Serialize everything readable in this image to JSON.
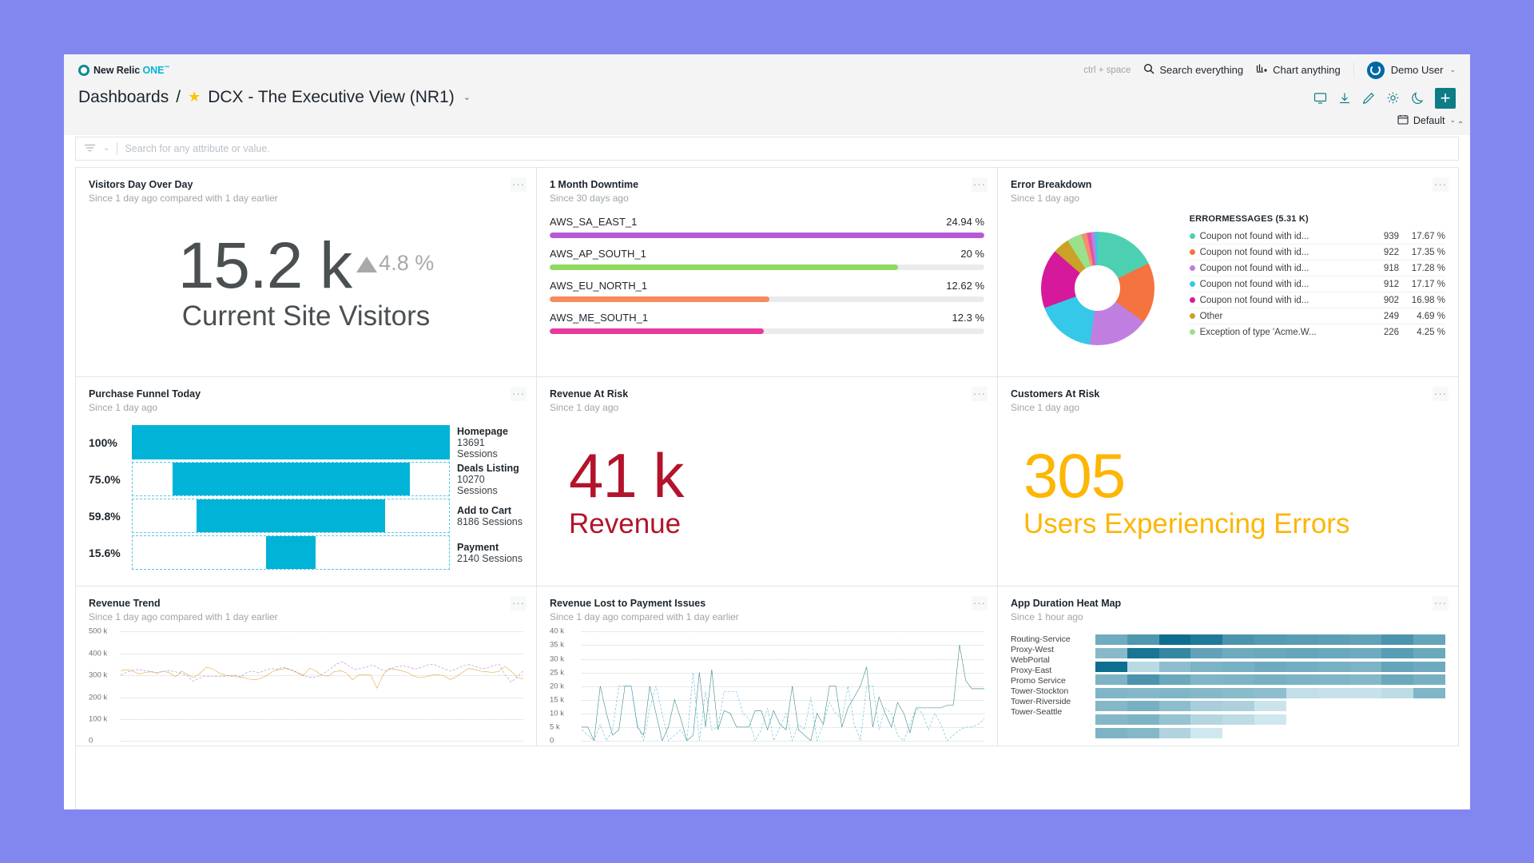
{
  "app": {
    "logo_text": "New Relic",
    "logo_one": "ONE",
    "logo_tm": "™"
  },
  "topbar": {
    "kbd_hint": "ctrl + space",
    "search_label": "Search everything",
    "chart_label": "Chart anything",
    "user_name": "Demo User",
    "caret": "⌄"
  },
  "breadcrumb": {
    "root": "Dashboards",
    "separator": "/",
    "star": "★",
    "title": "DCX - The Executive View (NR1)",
    "caret": "⌄",
    "default_label": "Default",
    "collapse": "⌃"
  },
  "filter": {
    "placeholder": "Search for any attribute or value.",
    "caret": "⌄"
  },
  "panels": {
    "visitors": {
      "title": "Visitors Day Over Day",
      "subtitle": "Since 1 day ago compared with 1 day earlier",
      "value": "15.2 k",
      "compare_pct": "4.8 %",
      "label": "Current Site Visitors",
      "menu": "···"
    },
    "downtime": {
      "title": "1 Month Downtime",
      "subtitle": "Since 30 days ago",
      "menu": "···"
    },
    "errors": {
      "title": "Error Breakdown",
      "subtitle": "Since 1 day ago",
      "legend_title": "ERRORMESSAGES (5.31 K)",
      "menu": "···"
    },
    "funnel": {
      "title": "Purchase Funnel Today",
      "subtitle": "Since 1 day ago",
      "menu": "···"
    },
    "revenue_risk": {
      "title": "Revenue At Risk",
      "subtitle": "Since 1 day ago",
      "value": "41 k",
      "label": "Revenue",
      "menu": "···"
    },
    "customers_risk": {
      "title": "Customers At Risk",
      "subtitle": "Since 1 day ago",
      "value": "305",
      "label": "Users Experiencing Errors",
      "menu": "···"
    },
    "revenue_trend": {
      "title": "Revenue Trend",
      "subtitle": "Since 1 day ago compared with 1 day earlier",
      "menu": "···"
    },
    "revenue_lost": {
      "title": "Revenue Lost to Payment Issues",
      "subtitle": "Since 1 day ago compared with 1 day earlier",
      "menu": "···"
    },
    "heatmap": {
      "title": "App Duration Heat Map",
      "subtitle": "Since 1 hour ago",
      "menu": "···"
    }
  },
  "chart_data": [
    {
      "type": "bar",
      "title": "1 Month Downtime",
      "orientation": "horizontal",
      "categories": [
        "AWS_SA_EAST_1",
        "AWS_AP_SOUTH_1",
        "AWS_EU_NORTH_1",
        "AWS_ME_SOUTH_1"
      ],
      "values": [
        24.94,
        20,
        12.62,
        12.3
      ],
      "value_labels": [
        "24.94 %",
        "20 %",
        "12.62 %",
        "12.3 %"
      ],
      "colors": [
        "#b55ad6",
        "#8ed95e",
        "#f68b5c",
        "#e8399e"
      ],
      "max": 24.94,
      "ylabel": "",
      "xlabel": ""
    },
    {
      "type": "pie",
      "title": "Error Breakdown",
      "legend_title": "ERRORMESSAGES (5.31 K)",
      "labels": [
        "Coupon not found with id...",
        "Coupon not found with id...",
        "Coupon not found with id...",
        "Coupon not found with id...",
        "Coupon not found with id...",
        "Other",
        "Exception of type 'Acme.W..."
      ],
      "counts": [
        939,
        922,
        918,
        912,
        902,
        249,
        226
      ],
      "percents": [
        "17.67 %",
        "17.35 %",
        "17.28 %",
        "17.17 %",
        "16.98 %",
        "4.69 %",
        "4.25 %"
      ],
      "values": [
        17.67,
        17.35,
        17.28,
        17.17,
        16.98,
        4.69,
        4.25
      ],
      "colors": [
        "#4dd0b1",
        "#f4733f",
        "#c07ee0",
        "#35c8e8",
        "#d6199c",
        "#c9a227",
        "#9be08a"
      ],
      "extra_slices": [
        {
          "value": 1.6,
          "color": "#f88d6e"
        },
        {
          "value": 1.2,
          "color": "#e0569f"
        },
        {
          "value": 1.0,
          "color": "#c07ee0"
        },
        {
          "value": 0.9,
          "color": "#35c8e8"
        }
      ]
    },
    {
      "type": "bar",
      "title": "Purchase Funnel Today",
      "orientation": "funnel",
      "categories": [
        "Homepage",
        "Deals Listing",
        "Add to Cart",
        "Payment"
      ],
      "percent_labels": [
        "100%",
        "75.0%",
        "59.8%",
        "15.6%"
      ],
      "values": [
        100,
        75.0,
        59.8,
        15.6
      ],
      "sessions": [
        "13691 Sessions",
        "10270 Sessions",
        "8186 Sessions",
        "2140 Sessions"
      ],
      "color": "#00b3d7"
    },
    {
      "type": "line",
      "title": "Revenue Trend",
      "ylabel": "",
      "xlabel": "",
      "ylim": [
        0,
        500000
      ],
      "ticks": [
        "500 k",
        "400 k",
        "300 k",
        "200 k",
        "100 k",
        "0"
      ],
      "tick_values": [
        500000,
        400000,
        300000,
        200000,
        100000,
        0
      ],
      "grid": true,
      "series": [
        {
          "name": "current",
          "color": "#e0a52d",
          "style": "solid",
          "values": [
            320,
            325,
            318,
            305,
            312,
            315,
            308,
            318,
            310,
            292,
            318,
            302,
            288,
            308,
            335,
            330,
            312,
            300,
            295,
            292,
            290,
            282,
            278,
            285,
            298,
            318,
            325,
            330,
            322,
            310,
            300,
            332,
            318,
            298,
            295,
            315,
            320,
            310,
            278,
            300,
            302,
            300,
            240,
            300,
            330,
            326,
            320,
            312,
            296,
            288,
            292,
            300,
            302,
            296,
            280,
            292,
            312,
            330,
            326,
            318,
            315,
            312,
            316,
            340,
            318,
            290,
            282
          ]
        },
        {
          "name": "previous",
          "color": "#9b7fd4",
          "style": "dashed",
          "values": [
            300,
            312,
            322,
            326,
            320,
            316,
            312,
            316,
            320,
            316,
            308,
            300,
            272,
            285,
            296,
            292,
            294,
            292,
            298,
            300,
            292,
            312,
            318,
            310,
            322,
            330,
            326,
            336,
            328,
            318,
            300,
            292,
            288,
            296,
            312,
            330,
            352,
            360,
            340,
            326,
            330,
            338,
            346,
            330,
            318,
            330,
            338,
            342,
            336,
            328,
            334,
            346,
            350,
            338,
            326,
            318,
            330,
            342,
            348,
            340,
            330,
            332,
            344,
            348,
            300,
            268,
            292,
            320
          ]
        }
      ]
    },
    {
      "type": "line",
      "title": "Revenue Lost to Payment Issues",
      "ylabel": "",
      "xlabel": "",
      "ylim": [
        0,
        40000
      ],
      "ticks": [
        "40 k",
        "35 k",
        "30 k",
        "25 k",
        "20 k",
        "15 k",
        "10 k",
        "5 k",
        "0"
      ],
      "tick_values": [
        40000,
        35000,
        30000,
        25000,
        20000,
        15000,
        10000,
        5000,
        0
      ],
      "grid": true,
      "series": [
        {
          "name": "current",
          "color": "#2d7f7a",
          "style": "solid",
          "values": [
            5,
            5,
            0,
            20,
            10,
            2,
            4,
            20,
            20,
            5,
            2,
            20,
            10,
            0,
            5,
            15,
            8,
            0,
            2,
            25,
            5,
            26,
            4,
            11,
            10,
            5,
            5,
            5,
            11,
            11,
            4,
            11,
            6,
            4,
            20,
            4,
            2,
            0,
            10,
            6,
            20,
            20,
            5,
            12,
            16,
            20,
            27,
            5,
            16,
            10,
            5,
            14,
            10,
            3,
            12,
            12,
            12,
            12,
            12,
            13,
            13,
            35,
            22,
            19,
            19,
            19
          ]
        },
        {
          "name": "previous",
          "color": "#4fb3d9",
          "style": "dashed",
          "values": [
            4,
            2,
            0,
            6,
            0,
            4,
            20,
            20,
            20,
            6,
            0,
            12,
            20,
            10,
            0,
            2,
            4,
            0,
            25,
            0,
            18,
            4,
            5,
            18,
            18,
            18,
            10,
            8,
            0,
            4,
            12,
            0,
            5,
            10,
            0,
            6,
            4,
            16,
            0,
            6,
            14,
            10,
            8,
            20,
            6,
            0,
            20,
            20,
            4,
            12,
            10,
            2,
            0,
            6,
            12,
            10,
            4,
            10,
            6,
            0,
            2,
            4,
            5,
            5,
            6,
            8
          ]
        }
      ]
    },
    {
      "type": "heatmap",
      "title": "App Duration Heat Map",
      "rows": [
        "Routing-Service",
        "Proxy-West",
        "WebPortal",
        "Proxy-East",
        "Promo Service",
        "Tower-Stockton",
        "Tower-Riverside",
        "Tower-Seattle"
      ],
      "columns": 11,
      "color_scale_low": "#eaf7fb",
      "color_scale_high": "#0d6e8f",
      "values": [
        [
          0.55,
          0.7,
          1.0,
          0.92,
          0.72,
          0.68,
          0.66,
          0.64,
          0.62,
          0.72,
          0.6
        ],
        [
          0.45,
          0.95,
          0.82,
          0.62,
          0.56,
          0.58,
          0.6,
          0.58,
          0.56,
          0.66,
          0.58
        ],
        [
          1.0,
          0.22,
          0.42,
          0.5,
          0.52,
          0.56,
          0.54,
          0.52,
          0.5,
          0.6,
          0.56
        ],
        [
          0.5,
          0.72,
          0.58,
          0.48,
          0.5,
          0.52,
          0.5,
          0.48,
          0.46,
          0.58,
          0.52
        ],
        [
          0.48,
          0.46,
          0.48,
          0.46,
          0.44,
          0.42,
          0.18,
          0.16,
          0.16,
          0.2,
          0.48
        ],
        [
          0.46,
          0.52,
          0.42,
          0.3,
          0.28,
          0.14,
          0,
          0,
          0,
          0,
          0
        ],
        [
          0.46,
          0.5,
          0.38,
          0.24,
          0.2,
          0.12,
          0,
          0,
          0,
          0,
          0
        ],
        [
          0.5,
          0.46,
          0.26,
          0.12,
          0,
          0,
          0,
          0,
          0,
          0,
          0
        ]
      ]
    }
  ]
}
